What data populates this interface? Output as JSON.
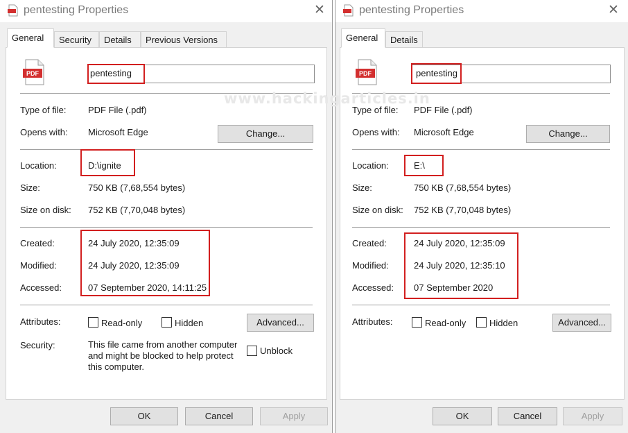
{
  "watermark": "www.hackingarticles.in",
  "colors": {
    "highlight_border": "#d21f1f",
    "pdf_red": "#d32f2f",
    "dialog_bg": "#f0f0f0"
  },
  "left": {
    "title": "pentesting Properties",
    "tabs": [
      "General",
      "Security",
      "Details",
      "Previous Versions"
    ],
    "file_name": "pentesting",
    "icon_label": "PDF",
    "labels": {
      "type": "Type of file:",
      "opens": "Opens with:",
      "location": "Location:",
      "size": "Size:",
      "size_on_disk": "Size on disk:",
      "created": "Created:",
      "modified": "Modified:",
      "accessed": "Accessed:",
      "attributes": "Attributes:",
      "security": "Security:"
    },
    "values": {
      "type": "PDF File (.pdf)",
      "opens": "Microsoft Edge",
      "location": "D:\\ignite",
      "size": "750 KB (7,68,554 bytes)",
      "size_on_disk": "752 KB (7,70,048 bytes)",
      "created": "24 July 2020, 12:35:09",
      "modified": "24 July 2020, 12:35:09",
      "accessed": "07 September 2020, 14:11:25"
    },
    "change_button": "Change...",
    "readonly": "Read-only",
    "hidden": "Hidden",
    "advanced_button": "Advanced...",
    "security_text": "This file came from another computer and might be blocked to help protect this computer.",
    "unblock": "Unblock",
    "ok": "OK",
    "cancel": "Cancel",
    "apply": "Apply"
  },
  "right": {
    "title": "pentesting Properties",
    "tabs": [
      "General",
      "Details"
    ],
    "file_name": "pentesting",
    "icon_label": "PDF",
    "labels": {
      "type": "Type of file:",
      "opens": "Opens with:",
      "location": "Location:",
      "size": "Size:",
      "size_on_disk": "Size on disk:",
      "created": "Created:",
      "modified": "Modified:",
      "accessed": "Accessed:",
      "attributes": "Attributes:"
    },
    "values": {
      "type": "PDF File (.pdf)",
      "opens": "Microsoft Edge",
      "location": "E:\\",
      "size": "750 KB (7,68,554 bytes)",
      "size_on_disk": "752 KB (7,70,048 bytes)",
      "created": "24 July 2020, 12:35:09",
      "modified": "24 July 2020, 12:35:10",
      "accessed": "07 September 2020"
    },
    "change_button": "Change...",
    "readonly": "Read-only",
    "hidden": "Hidden",
    "advanced_button": "Advanced...",
    "ok": "OK",
    "cancel": "Cancel",
    "apply": "Apply"
  }
}
